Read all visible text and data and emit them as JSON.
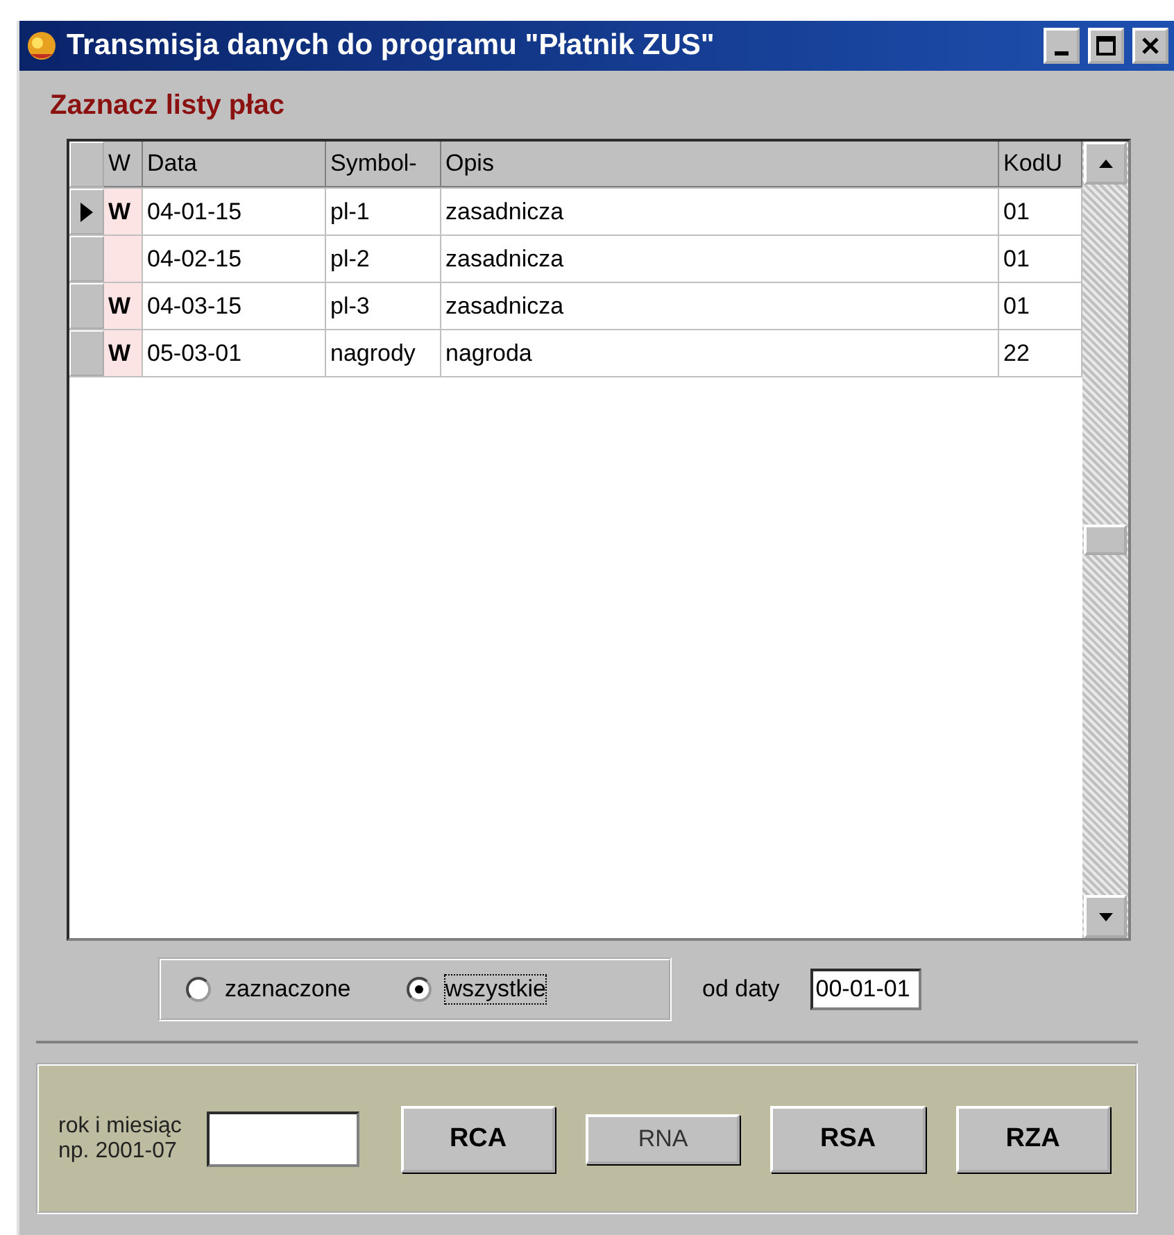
{
  "window": {
    "title": "Transmisja danych do programu \"Płatnik ZUS\""
  },
  "caption": "Zaznacz listy płac",
  "table": {
    "columns": [
      "W",
      "Data",
      "Symbol-",
      "Opis",
      "KodU"
    ],
    "rows": [
      {
        "selected": true,
        "w": "W",
        "data": "04-01-15",
        "symbol": "pl-1",
        "opis": "zasadnicza",
        "kod": "01"
      },
      {
        "selected": false,
        "data": "04-02-15",
        "symbol": "pl-2",
        "opis": "zasadnicza",
        "kod": "01"
      },
      {
        "selected": false,
        "w": "W",
        "data": "04-03-15",
        "symbol": "pl-3",
        "opis": "zasadnicza",
        "kod": "01"
      },
      {
        "selected": false,
        "w": "W",
        "data": "05-03-01",
        "symbol": "nagrody",
        "opis": "nagroda",
        "kod": "22"
      }
    ]
  },
  "filter": {
    "options": [
      {
        "label": "zaznaczone",
        "selected": false
      },
      {
        "label": "wszystkie",
        "selected": true
      }
    ],
    "date_label": "od daty",
    "date_value": "00-01-01"
  },
  "report": {
    "label_lines": [
      "rok i miesiąc",
      "np. 2001-07"
    ],
    "buttons": [
      {
        "label": "RCA",
        "emphasized": true
      },
      {
        "label": "RNA",
        "emphasized": false
      },
      {
        "label": "RSA",
        "emphasized": true
      },
      {
        "label": "RZA",
        "emphasized": true
      }
    ]
  }
}
